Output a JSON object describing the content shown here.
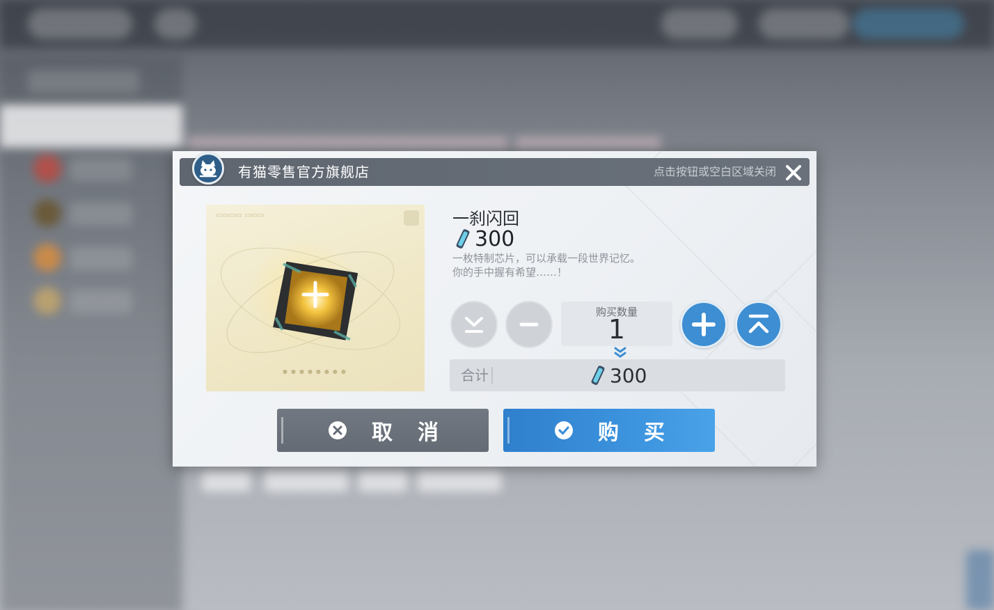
{
  "dialog": {
    "store_name": "有猫零售官方旗舰店",
    "close_hint": "点击按钮或空白区域关闭"
  },
  "item": {
    "name": "一刹闪回",
    "price": "300",
    "description_line1": "一枚特制芯片，可以承载一段世界记忆。",
    "description_line2": "你的手中握有希望……！"
  },
  "quantity": {
    "label": "购买数量",
    "value": "1"
  },
  "total": {
    "label": "合计",
    "value": "300"
  },
  "buttons": {
    "cancel": "取消",
    "buy": "购买"
  },
  "colors": {
    "accent_blue": "#3d8ed2",
    "header_gray": "#646b74",
    "dialog_bg": "#f0f3f6"
  },
  "icons": [
    "cat-logo-icon",
    "close-icon",
    "crystal-currency-icon",
    "min-quantity-icon",
    "minus-icon",
    "plus-icon",
    "max-quantity-icon",
    "arrow-down-icon",
    "cancel-x-icon",
    "check-icon"
  ]
}
